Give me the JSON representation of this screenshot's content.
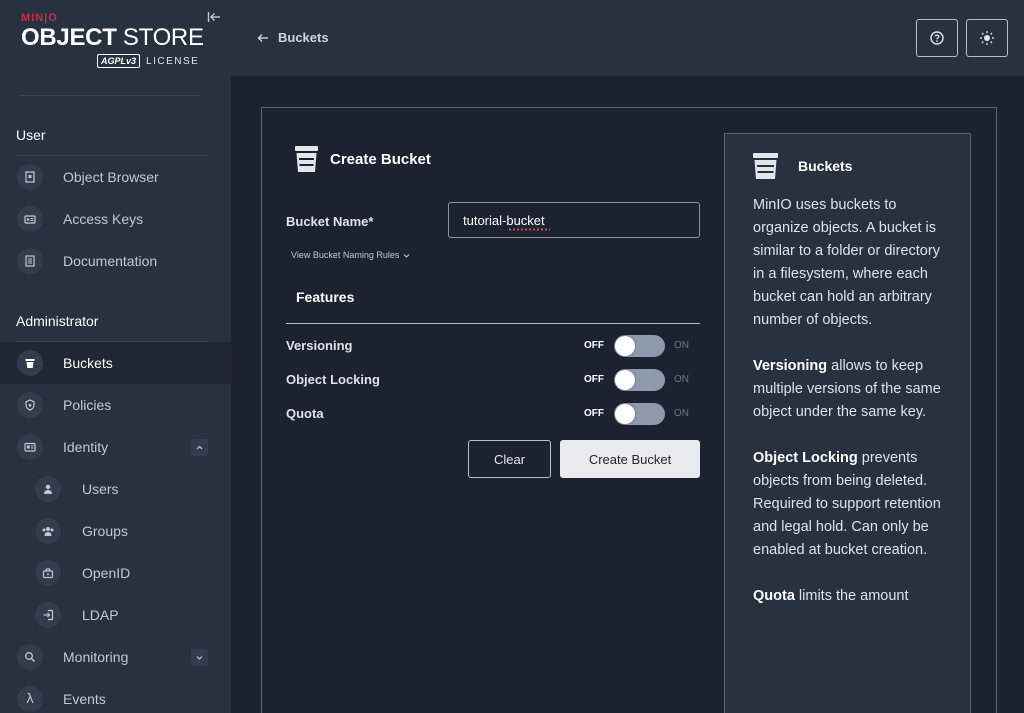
{
  "logo": {
    "brand": "MIN|O",
    "product_bold": "OBJECT",
    "product_light": " STORE",
    "badge": "AGPLv3",
    "license": "LICENSE"
  },
  "sidebar": {
    "section_user": "User",
    "user_items": [
      {
        "label": "Object Browser",
        "icon": "object-browser-icon"
      },
      {
        "label": "Access Keys",
        "icon": "key-icon"
      },
      {
        "label": "Documentation",
        "icon": "document-icon"
      }
    ],
    "section_admin": "Administrator",
    "admin_items": [
      {
        "label": "Buckets",
        "icon": "bucket-icon",
        "active": true
      },
      {
        "label": "Policies",
        "icon": "shield-icon"
      },
      {
        "label": "Identity",
        "icon": "id-card-icon",
        "expanded": true
      },
      {
        "label": "Users",
        "icon": "user-icon"
      },
      {
        "label": "Groups",
        "icon": "group-icon"
      },
      {
        "label": "OpenID",
        "icon": "openid-icon"
      },
      {
        "label": "LDAP",
        "icon": "login-icon"
      },
      {
        "label": "Monitoring",
        "icon": "magnifier-icon"
      },
      {
        "label": "Events",
        "icon": "lambda-icon"
      }
    ]
  },
  "header": {
    "back_label": "Buckets",
    "help_icon": "question-icon",
    "theme_icon": "sun-icon"
  },
  "form": {
    "title": "Create Bucket",
    "bucket_name_label": "Bucket Name*",
    "bucket_name_value": "tutorial-bucket",
    "naming_rules_link": "View Bucket Naming Rules",
    "features_title": "Features",
    "toggles": [
      {
        "label": "Versioning",
        "off": "OFF",
        "on": "ON",
        "state": false
      },
      {
        "label": "Object Locking",
        "off": "OFF",
        "on": "ON",
        "state": false
      },
      {
        "label": "Quota",
        "off": "OFF",
        "on": "ON",
        "state": false
      }
    ],
    "clear_button": "Clear",
    "create_button": "Create Bucket"
  },
  "help": {
    "title": "Buckets",
    "p1": "MinIO uses buckets to organize objects. A bucket is similar to a folder or directory in a filesystem, where each bucket can hold an arbitrary number of objects.",
    "p2_bold": "Versioning",
    "p2": " allows to keep multiple versions of the same object under the same key.",
    "p3_bold": "Object Locking",
    "p3": " prevents objects from being deleted. Required to support retention and legal hold. Can only be enabled at bucket creation.",
    "p4_bold": "Quota",
    "p4": " limits the amount"
  },
  "colors": {
    "sidebar": "#283140",
    "background": "#1c2230",
    "brand_red": "#c72c48"
  }
}
